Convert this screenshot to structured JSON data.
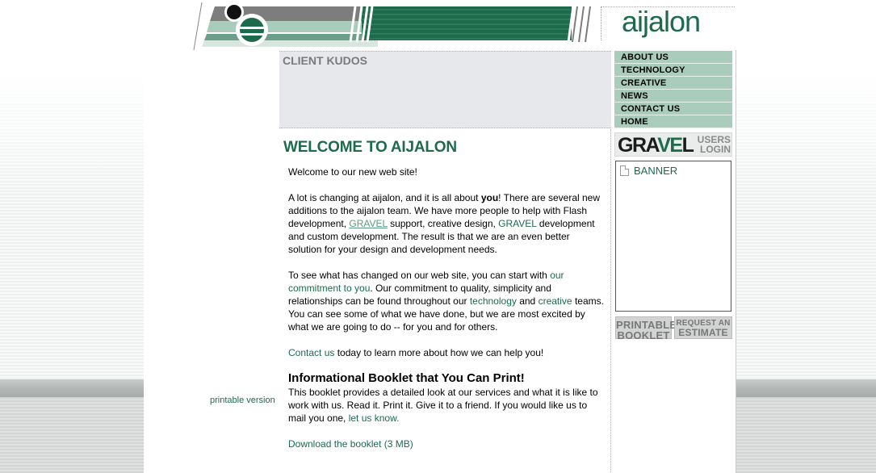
{
  "brand": {
    "logo_text": "aijalon",
    "accent_color": "#1d6b4c",
    "nav_color": "#a9ccbc"
  },
  "kudos": {
    "title": "CLIENT KUDOS"
  },
  "nav": {
    "items": [
      "ABOUT US",
      "TECHNOLOGY",
      "CREATIVE",
      "NEWS",
      "CONTACT US",
      "HOME"
    ]
  },
  "gravel": {
    "logo_pre": "GRA",
    "logo_ve": "VE",
    "logo_post": "L",
    "login_line1": "USERS",
    "login_line2": "LOGIN"
  },
  "banner": {
    "icon": "broken-image-icon",
    "label": "BANNER"
  },
  "buttons": {
    "printable_line1": "PRINTABLE",
    "printable_line2": "BOOKLET",
    "request_line1": "REQUEST AN",
    "request_line2": "ESTIMATE"
  },
  "main": {
    "heading": "WELCOME TO AIJALON",
    "intro": "Welcome to our new web site!",
    "p2_a": "A lot is changing at aijalon, and it is all about ",
    "p2_bold": "you",
    "p2_b": "! There are several new additions to the aijalon team. We have more people to help with Flash development, ",
    "p2_link1": "GRAVEL",
    "p2_c": " support, creative design, ",
    "p2_link2": "GRAVEL",
    "p2_d": " development and custom development. The result is that we are an even better solution for your design and development needs.",
    "p3_a": "To see what has changed on our web site, you can start with ",
    "p3_link1": "our commitment to you",
    "p3_b": ". Our commitment to quality, simplicity and relationships can be found throughout our ",
    "p3_link2": "technology",
    "p3_c": " and ",
    "p3_link3": "creative",
    "p3_d": " teams. You can see some of what we have done, but we are most excited by what we are going to do -- for you and for others.",
    "p4_link": "Contact us",
    "p4_rest": " today to learn more about how we can help you!",
    "booklet_heading": "Informational Booklet that You Can Print!",
    "booklet_a": "This booklet provides a detailed look at our services and what it is like to work with us. Read it. Print it. Give it to a friend. If you would like us to mail you one, ",
    "booklet_link": "let us know.",
    "download_link": "Download the booklet (3 MB)",
    "printable_version": "printable version"
  }
}
